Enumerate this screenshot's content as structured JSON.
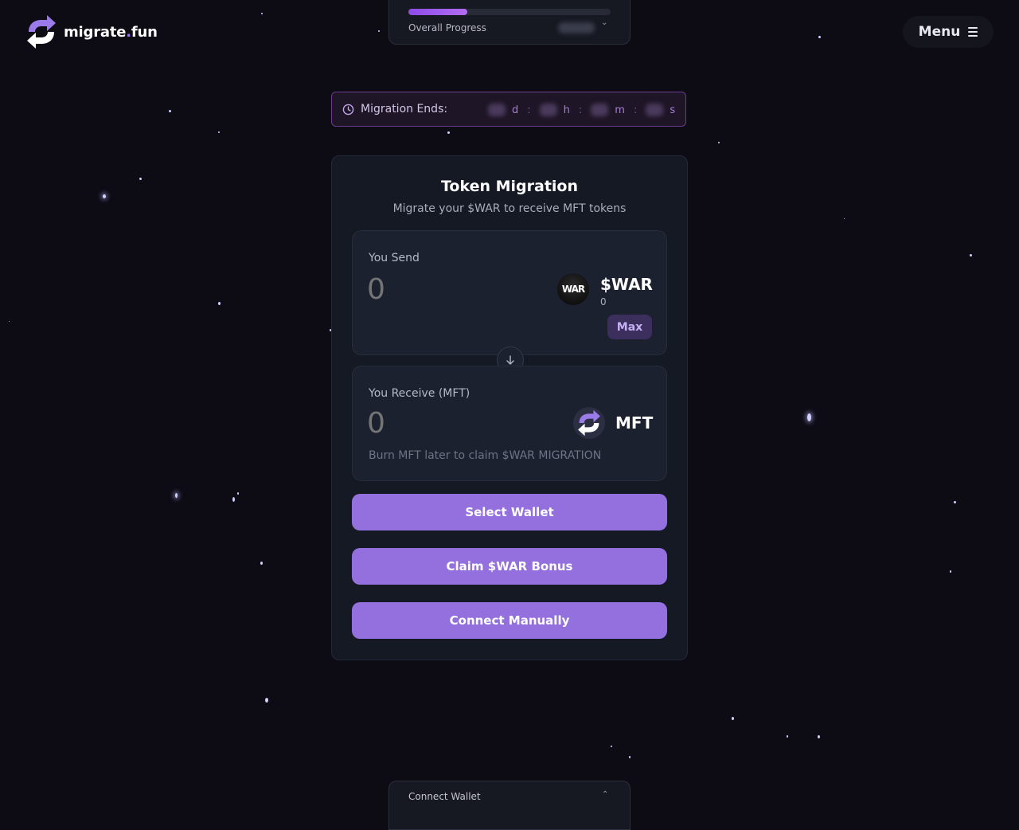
{
  "header": {
    "logo_text": "migrate",
    "logo_dot": ".",
    "logo_suffix": "fun",
    "menu_label": "Menu"
  },
  "progress": {
    "label": "Overall Progress",
    "fraction": 0.29
  },
  "countdown": {
    "label": "Migration Ends:",
    "units": [
      "d",
      "h",
      "m",
      "s"
    ],
    "separator": ":"
  },
  "card": {
    "title": "Token Migration",
    "subtitle": "Migrate your $WAR to receive MFT tokens",
    "send": {
      "label": "You Send",
      "amount_placeholder": "0",
      "token": "$WAR",
      "token_icon_text": "WAR",
      "balance": "0",
      "max_label": "Max"
    },
    "receive": {
      "label": "You Receive (MFT)",
      "amount_placeholder": "0",
      "token": "MFT",
      "note": "Burn MFT later to claim $WAR MIGRATION"
    },
    "buttons": {
      "select_wallet": "Select Wallet",
      "claim_bonus": "Claim $WAR Bonus",
      "connect_manually": "Connect Manually"
    }
  },
  "bottom_panel": {
    "label": "Connect Wallet"
  },
  "colors": {
    "accent": "#9370de",
    "background": "#0d0b14",
    "progress_fill": "#9d57ee"
  }
}
